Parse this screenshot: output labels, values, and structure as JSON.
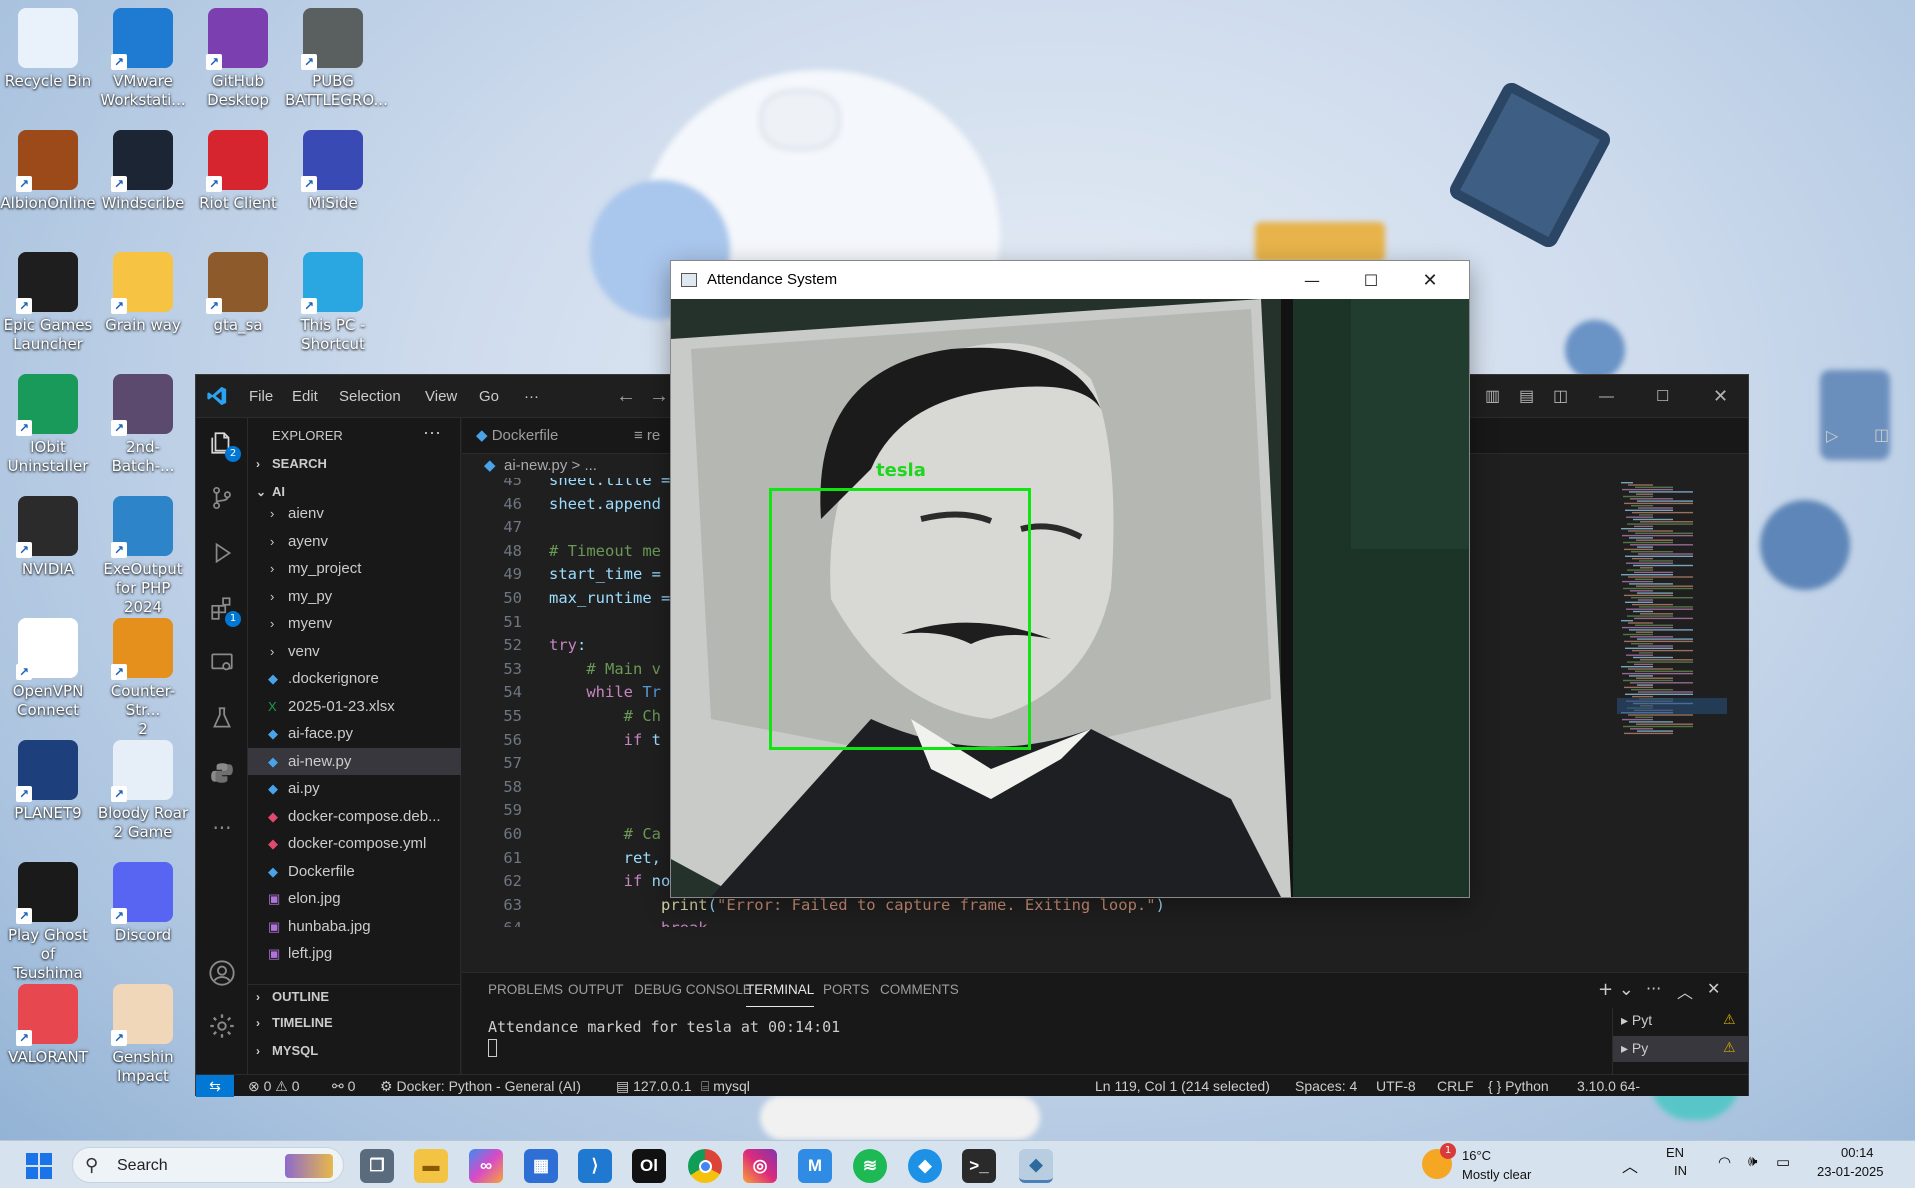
{
  "desktop": {
    "icons": [
      {
        "label1": "Recycle Bin",
        "label2": "",
        "color": "#e9f1fb"
      },
      {
        "label1": "VMware",
        "label2": "Workstati...",
        "color": "#1f7ad1"
      },
      {
        "label1": "GitHub",
        "label2": "Desktop",
        "color": "#7b3fb0"
      },
      {
        "label1": "PUBG",
        "label2": "BATTLEGRO...",
        "color": "#5a5f5f"
      },
      {
        "label1": "AlbionOnline",
        "label2": "",
        "color": "#9c4a1a"
      },
      {
        "label1": "Windscribe",
        "label2": "",
        "color": "#1c2533"
      },
      {
        "label1": "Riot Client",
        "label2": "",
        "color": "#d6252e"
      },
      {
        "label1": "MiSide",
        "label2": "",
        "color": "#3a4ab5"
      },
      {
        "label1": "Epic Games",
        "label2": "Launcher",
        "color": "#1e1e1e"
      },
      {
        "label1": "Grain way",
        "label2": "",
        "color": "#f6c343"
      },
      {
        "label1": "gta_sa",
        "label2": "",
        "color": "#8d5a2c"
      },
      {
        "label1": "This PC -",
        "label2": "Shortcut",
        "color": "#2aa6e0"
      },
      {
        "label1": "IObit",
        "label2": "Uninstaller",
        "color": "#19995a"
      },
      {
        "label1": "2nd-Batch-...",
        "label2": "",
        "color": "#5b4a6d"
      },
      {
        "label1": "NVIDIA",
        "label2": "",
        "color": "#2b2b2b"
      },
      {
        "label1": "ExeOutput",
        "label2": "for PHP 2024",
        "color": "#2d84c9"
      },
      {
        "label1": "OpenVPN",
        "label2": "Connect",
        "color": "#ffffff"
      },
      {
        "label1": "Counter-Str...",
        "label2": "2",
        "color": "#e58f1c"
      },
      {
        "label1": "PLANET9",
        "label2": "",
        "color": "#1d3f7b"
      },
      {
        "label1": "Bloody Roar",
        "label2": "2 Game",
        "color": "#e6eef7"
      },
      {
        "label1": "Play Ghost of",
        "label2": "Tsushima",
        "color": "#1a1a1a"
      },
      {
        "label1": "Discord",
        "label2": "",
        "color": "#5865f2"
      },
      {
        "label1": "VALORANT",
        "label2": "",
        "color": "#e7474f"
      },
      {
        "label1": "Genshin",
        "label2": "Impact",
        "color": "#f0d7b9"
      }
    ]
  },
  "vscode": {
    "menu": [
      "File",
      "Edit",
      "Selection",
      "View",
      "Go",
      "···"
    ],
    "explorer_title": "EXPLORER",
    "sections": {
      "search": "SEARCH",
      "ai": "AI",
      "outline": "OUTLINE",
      "timeline": "TIMELINE",
      "mysql": "MYSQL"
    },
    "tree": [
      {
        "icon": "›",
        "label": "aienv",
        "kind": "folder"
      },
      {
        "icon": "›",
        "label": "ayenv",
        "kind": "folder"
      },
      {
        "icon": "›",
        "label": "my_project",
        "kind": "folder"
      },
      {
        "icon": "›",
        "label": "my_py",
        "kind": "folder"
      },
      {
        "icon": "›",
        "label": "myenv",
        "kind": "folder"
      },
      {
        "icon": "›",
        "label": "venv",
        "kind": "folder"
      },
      {
        "icon": "◆",
        "label": ".dockerignore",
        "kind": "docker"
      },
      {
        "icon": "X",
        "label": "2025-01-23.xlsx",
        "kind": "xlsx"
      },
      {
        "icon": "◆",
        "label": "ai-face.py",
        "kind": "py"
      },
      {
        "icon": "◆",
        "label": "ai-new.py",
        "kind": "py"
      },
      {
        "icon": "◆",
        "label": "ai.py",
        "kind": "py"
      },
      {
        "icon": "◆",
        "label": "docker-compose.deb...",
        "kind": "compose"
      },
      {
        "icon": "◆",
        "label": "docker-compose.yml",
        "kind": "compose"
      },
      {
        "icon": "◆",
        "label": "Dockerfile",
        "kind": "docker"
      },
      {
        "icon": "▣",
        "label": "elon.jpg",
        "kind": "img"
      },
      {
        "icon": "▣",
        "label": "hunbaba.jpg",
        "kind": "img"
      },
      {
        "icon": "▣",
        "label": "left.jpg",
        "kind": "img"
      }
    ],
    "tabs": [
      "Dockerfile",
      "re"
    ],
    "breadcrumb": "ai-new.py > ...",
    "code_lines": [
      {
        "n": "45",
        "parts": [
          [
            "",
            "sheet.title ="
          ]
        ]
      },
      {
        "n": "46",
        "parts": [
          [
            "",
            "sheet.append"
          ]
        ]
      },
      {
        "n": "47",
        "parts": []
      },
      {
        "n": "48",
        "parts": [
          [
            "cm",
            "# Timeout me"
          ]
        ]
      },
      {
        "n": "49",
        "parts": [
          [
            "",
            "start_time ="
          ]
        ]
      },
      {
        "n": "50",
        "parts": [
          [
            "",
            "max_runtime ="
          ]
        ]
      },
      {
        "n": "51",
        "parts": []
      },
      {
        "n": "52",
        "parts": [
          [
            "kw",
            "try"
          ],
          [
            "",
            ":"
          ]
        ]
      },
      {
        "n": "53",
        "parts": [
          [
            "cm",
            "    # Main v"
          ]
        ]
      },
      {
        "n": "54",
        "parts": [
          [
            "kw",
            "    while "
          ],
          [
            "kw2",
            "Tr"
          ]
        ]
      },
      {
        "n": "55",
        "parts": [
          [
            "cm",
            "        # Ch"
          ]
        ]
      },
      {
        "n": "56",
        "parts": [
          [
            "kw",
            "        if "
          ],
          [
            "",
            "t"
          ]
        ]
      },
      {
        "n": "57",
        "parts": []
      },
      {
        "n": "58",
        "parts": []
      },
      {
        "n": "59",
        "parts": []
      },
      {
        "n": "60",
        "parts": [
          [
            "cm",
            "        # Ca"
          ]
        ]
      },
      {
        "n": "61",
        "parts": [
          [
            "",
            "        ret,"
          ]
        ]
      },
      {
        "n": "62",
        "parts": [
          [
            "kw",
            "        if "
          ],
          [
            "",
            "not ret:"
          ]
        ]
      },
      {
        "n": "63",
        "parts": [
          [
            "fn",
            "            print"
          ],
          [
            "",
            "("
          ],
          [
            "st",
            "\"Error: Failed to capture frame. Exiting loop.\""
          ],
          [
            "",
            ")"
          ]
        ]
      },
      {
        "n": "64",
        "parts": [
          [
            "kw",
            "            break"
          ]
        ]
      },
      {
        "n": "65",
        "parts": []
      }
    ],
    "panel_tabs": [
      "PROBLEMS",
      "OUTPUT",
      "DEBUG CONSOLE",
      "TERMINAL",
      "PORTS",
      "COMMENTS"
    ],
    "terminal_output": "Attendance marked for tesla at 00:14:01",
    "terminal_list": [
      "Pyt",
      "Py"
    ],
    "status": {
      "errors": "⊗ 0 ⚠ 0",
      "ports": "⚯ 0",
      "docker": "Docker: Python - General (AI)",
      "db": "127.0.0.1",
      "mysql": "mysql",
      "position": "Ln 119, Col 1 (214 selected)",
      "spaces": "Spaces: 4",
      "encoding": "UTF-8",
      "eol": "CRLF",
      "language": "{ } Python",
      "version": "3.10.0 64-"
    }
  },
  "attendance": {
    "title": "Attendance System",
    "face_label": "tesla"
  },
  "taskbar": {
    "search_placeholder": "Search",
    "weather_temp": "16°C",
    "weather_desc": "Mostly clear",
    "weather_badge": "1",
    "lang1": "EN",
    "lang2": "IN",
    "time": "00:14",
    "date": "23-01-2025"
  }
}
